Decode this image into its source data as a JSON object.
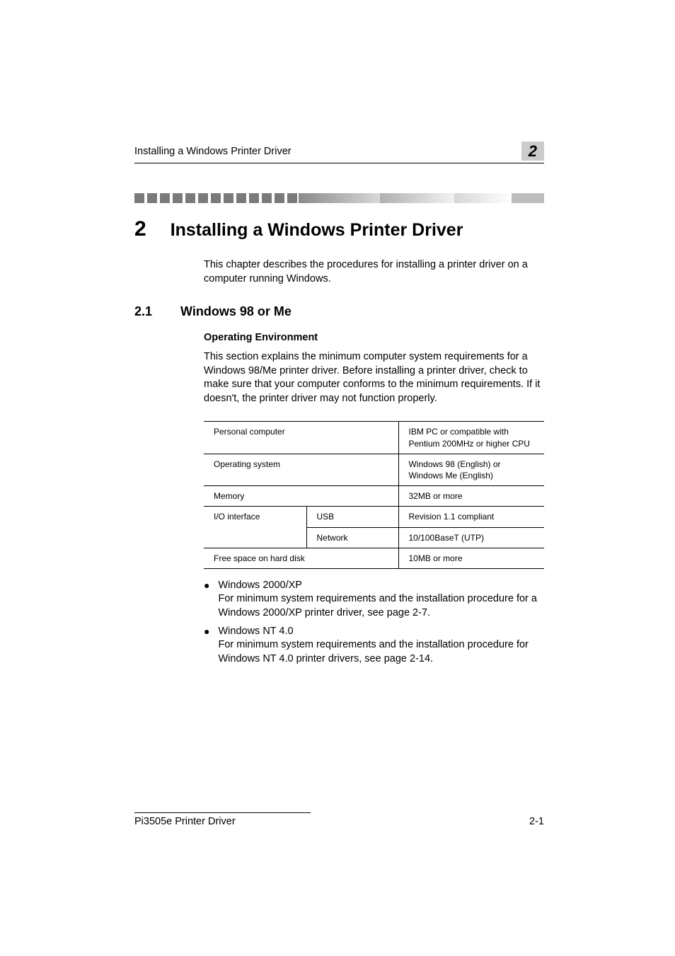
{
  "header": {
    "running_title": "Installing a Windows Printer Driver",
    "chapter_badge": "2"
  },
  "chapter": {
    "number": "2",
    "title": "Installing a Windows Printer Driver",
    "intro": "This chapter describes the procedures for installing a printer driver on a computer running Windows."
  },
  "section": {
    "number": "2.1",
    "title": "Windows 98 or Me"
  },
  "subheading": "Operating Environment",
  "env_paragraph": "This section explains the minimum computer system requirements for a Windows 98/Me printer driver. Before installing a printer driver, check to make sure that your computer conforms to the minimum requirements. If it doesn't, the printer driver may not function properly.",
  "table": {
    "rows": [
      {
        "label": "Personal computer",
        "sub": "",
        "value": "IBM PC or compatible with Pentium 200MHz or higher CPU"
      },
      {
        "label": "Operating system",
        "sub": "",
        "value": "Windows 98 (English) or Windows Me (English)"
      },
      {
        "label": "Memory",
        "sub": "",
        "value": "32MB or more"
      },
      {
        "label": "I/O interface",
        "sub": "USB",
        "value": "Revision 1.1 compliant"
      },
      {
        "label": "",
        "sub": "Network",
        "value": "10/100BaseT (UTP)"
      },
      {
        "label": "Free space on hard disk",
        "sub": "",
        "value": "10MB or more"
      }
    ]
  },
  "bullets": [
    {
      "title": "Windows 2000/XP",
      "text": "For minimum system requirements and the installation procedure for a Windows 2000/XP printer driver, see page 2-7."
    },
    {
      "title": "Windows NT 4.0",
      "text": "For minimum system requirements and the installation procedure for Windows NT 4.0 printer drivers, see page 2-14."
    }
  ],
  "footer": {
    "product": "Pi3505e Printer Driver",
    "page": "2-1"
  }
}
